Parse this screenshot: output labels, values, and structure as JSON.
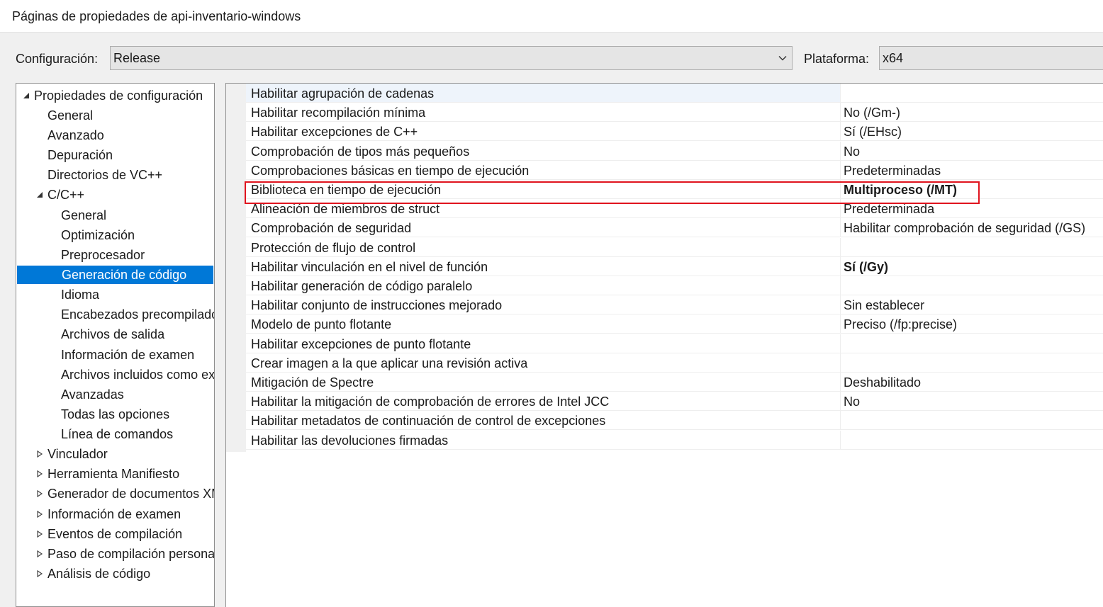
{
  "window": {
    "title": "Páginas de propiedades de api-inventario-windows"
  },
  "config": {
    "configuration_label": "Configuración:",
    "configuration_value": "Release",
    "platform_label": "Plataforma:",
    "platform_value": "x64"
  },
  "tree": {
    "items": [
      {
        "label": "Propiedades de configuración",
        "expander": "expanded"
      },
      {
        "label": "General",
        "expander": "none"
      },
      {
        "label": "Avanzado",
        "expander": "none"
      },
      {
        "label": "Depuración",
        "expander": "none"
      },
      {
        "label": "Directorios de VC++",
        "expander": "none"
      },
      {
        "label": "C/C++",
        "expander": "expanded"
      },
      {
        "label": "General",
        "expander": "none"
      },
      {
        "label": "Optimización",
        "expander": "none"
      },
      {
        "label": "Preprocesador",
        "expander": "none"
      },
      {
        "label": "Generación de código",
        "expander": "none",
        "selected": true
      },
      {
        "label": "Idioma",
        "expander": "none"
      },
      {
        "label": "Encabezados precompilados",
        "expander": "none"
      },
      {
        "label": "Archivos de salida",
        "expander": "none"
      },
      {
        "label": "Información de examen",
        "expander": "none"
      },
      {
        "label": "Archivos incluidos como externos",
        "expander": "none"
      },
      {
        "label": "Avanzadas",
        "expander": "none"
      },
      {
        "label": "Todas las opciones",
        "expander": "none"
      },
      {
        "label": "Línea de comandos",
        "expander": "none"
      },
      {
        "label": "Vinculador",
        "expander": "collapsed"
      },
      {
        "label": "Herramienta Manifiesto",
        "expander": "collapsed"
      },
      {
        "label": "Generador de documentos XML",
        "expander": "collapsed"
      },
      {
        "label": "Información de examen",
        "expander": "collapsed"
      },
      {
        "label": "Eventos de compilación",
        "expander": "collapsed"
      },
      {
        "label": "Paso de compilación personalizado",
        "expander": "collapsed"
      },
      {
        "label": "Análisis de código",
        "expander": "collapsed"
      }
    ]
  },
  "properties": [
    {
      "name": "Habilitar agrupación de cadenas",
      "value": ""
    },
    {
      "name": "Habilitar recompilación mínima",
      "value": "No (/Gm-)"
    },
    {
      "name": "Habilitar excepciones de C++",
      "value": "Sí (/EHsc)"
    },
    {
      "name": "Comprobación de tipos más pequeños",
      "value": "No"
    },
    {
      "name": "Comprobaciones básicas en tiempo de ejecución",
      "value": "Predeterminadas"
    },
    {
      "name": "Biblioteca en tiempo de ejecución",
      "value": "Multiproceso (/MT)",
      "bold": true,
      "highlighted": true
    },
    {
      "name": "Alineación de miembros de struct",
      "value": "Predeterminada"
    },
    {
      "name": "Comprobación de seguridad",
      "value": "Habilitar comprobación de seguridad (/GS)"
    },
    {
      "name": "Protección de flujo de control",
      "value": ""
    },
    {
      "name": "Habilitar vinculación en el nivel de función",
      "value": "Sí (/Gy)",
      "bold": true
    },
    {
      "name": "Habilitar generación de código paralelo",
      "value": ""
    },
    {
      "name": "Habilitar conjunto de instrucciones mejorado",
      "value": "Sin establecer"
    },
    {
      "name": "Modelo de punto flotante",
      "value": "Preciso (/fp:precise)"
    },
    {
      "name": "Habilitar excepciones de punto flotante",
      "value": ""
    },
    {
      "name": "Crear imagen a la que aplicar una revisión activa",
      "value": ""
    },
    {
      "name": "Mitigación de Spectre",
      "value": "Deshabilitado"
    },
    {
      "name": "Habilitar la mitigación de comprobación de errores de Intel JCC",
      "value": "No"
    },
    {
      "name": "Habilitar metadatos de continuación de control de excepciones",
      "value": ""
    },
    {
      "name": "Habilitar las devoluciones firmadas",
      "value": ""
    }
  ],
  "colors": {
    "selection": "#0078d7",
    "highlight_box": "#e0141e"
  }
}
